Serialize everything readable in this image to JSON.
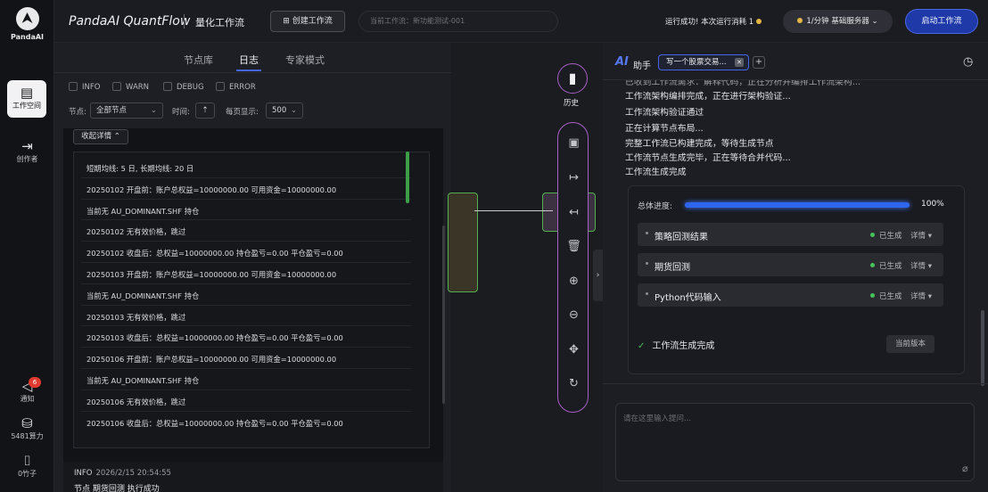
{
  "rail": {
    "logo_text": "PandaAI",
    "items": [
      {
        "label": "工作空间",
        "icon": "workspace-icon"
      },
      {
        "label": "创作者",
        "icon": "creator-icon"
      },
      {
        "label": "通知",
        "icon": "bell-icon",
        "badge": "6"
      },
      {
        "label": "5481算力",
        "icon": "compute-icon"
      },
      {
        "label": "0竹子",
        "icon": "bamboo-icon"
      }
    ]
  },
  "header": {
    "title": "PandaAI QuantFlow",
    "subtitle": "量化工作流",
    "create_btn": "创建工作流",
    "current_flow_label": "当前工作流：",
    "current_flow_value": "新功能测试-001",
    "run_status": "运行成功! 本次运行消耗 1",
    "server_select": "1/分钟  基础服务器",
    "start_btn": "启动工作流"
  },
  "left": {
    "tabs": [
      "节点库",
      "日志",
      "专家模式"
    ],
    "active_tab": "日志",
    "filters": {
      "levels": [
        "INFO",
        "WARN",
        "DEBUG",
        "ERROR"
      ],
      "node_label": "节点:",
      "node_value": "全部节点",
      "time_label": "时间:",
      "per_page_label": "每页显示:",
      "per_page_value": "500"
    },
    "collapse_btn": "收起详情",
    "log_lines": [
      "短期均线: 5 日, 长期均线: 20 日",
      "20250102 开盘前：账户总权益=10000000.00 可用资金=10000000.00",
      "当前无 AU_DOMINANT.SHF 持仓",
      "20250102 无有效价格，跳过",
      "20250102 收盘后：总权益=10000000.00 持仓盈亏=0.00 平仓盈亏=0.00",
      "20250103 开盘前：账户总权益=10000000.00 可用资金=10000000.00",
      "当前无 AU_DOMINANT.SHF 持仓",
      "20250103 无有效价格，跳过",
      "20250103 收盘后：总权益=10000000.00 持仓盈亏=0.00 平仓盈亏=0.00",
      "20250106 开盘前：账户总权益=10000000.00 可用资金=10000000.00",
      "当前无 AU_DOMINANT.SHF 持仓",
      "20250106 无有效价格，跳过",
      "20250106 收盘后：总权益=10000000.00 持仓盈亏=0.00 平仓盈亏=0.00"
    ],
    "footer": {
      "level": "INFO",
      "time": "2026/2/15 20:54:55",
      "message": "节点 期货回测 执行成功"
    }
  },
  "canvas": {
    "history_label": "历史",
    "tools": [
      "save-icon",
      "export-icon",
      "import-icon",
      "delete-icon",
      "zoom-in-icon",
      "zoom-out-icon",
      "fit-view-icon",
      "refresh-icon"
    ]
  },
  "assistant": {
    "title": "助手",
    "tab_label": "写一个股票交易...",
    "messages": [
      "已收到工作流需求：解释代码，正在分析并编排工作流架构...",
      "工作流架构编排完成，正在进行架构验证...",
      "工作流架构验证通过",
      "正在计算节点布局...",
      "完整工作流已构建完成，等待生成节点",
      "工作流节点生成完毕，正在等待合并代码...",
      "工作流生成完成"
    ],
    "progress": {
      "label": "总体进度:",
      "value": 100,
      "value_text": "100%"
    },
    "steps": [
      {
        "name": "策略回测结果",
        "status": "已生成",
        "detail": "详情 ▾"
      },
      {
        "name": "期货回测",
        "status": "已生成",
        "detail": "详情 ▾"
      },
      {
        "name": "Python代码输入",
        "status": "已生成",
        "detail": "详情 ▾"
      }
    ],
    "done_text": "工作流生成完成",
    "version_btn": "当前版本",
    "input_placeholder": "请在这里输入提问..."
  }
}
